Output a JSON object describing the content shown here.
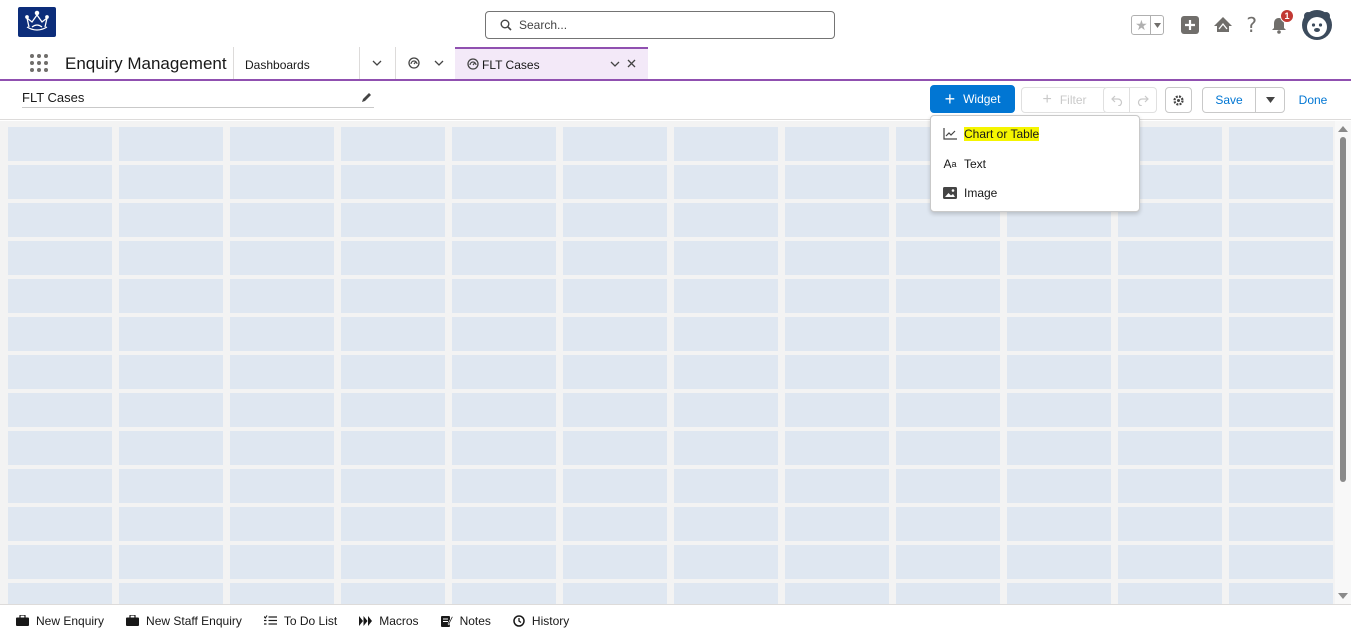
{
  "header": {
    "search_placeholder": "Search...",
    "notification_count": "1"
  },
  "nav": {
    "app_name": "Enquiry Management",
    "dashboards_label": "Dashboards",
    "active_tab_label": "FLT Cases"
  },
  "toolbar": {
    "dashboard_title": "FLT Cases",
    "widget_label": "Widget",
    "filter_label": "Filter",
    "save_label": "Save",
    "done_label": "Done"
  },
  "widget_menu": {
    "items": [
      {
        "label": "Chart or Table",
        "icon": "chart-icon"
      },
      {
        "label": "Text",
        "icon": "text-icon"
      },
      {
        "label": "Image",
        "icon": "image-icon"
      }
    ]
  },
  "utility_bar": {
    "items": [
      {
        "label": "New Enquiry",
        "icon": "briefcase-icon"
      },
      {
        "label": "New Staff Enquiry",
        "icon": "briefcase-icon"
      },
      {
        "label": "To Do List",
        "icon": "checklist-icon"
      },
      {
        "label": "Macros",
        "icon": "macros-icon"
      },
      {
        "label": "Notes",
        "icon": "notes-icon"
      },
      {
        "label": "History",
        "icon": "history-icon"
      }
    ]
  },
  "colors": {
    "brand_blue": "#0176d3",
    "app_purple": "#9050b0",
    "logo_navy": "#0c2d7a",
    "grid_cell": "#dfe7f1",
    "highlight_yellow": "#f5f500",
    "badge_red": "#c23934"
  }
}
